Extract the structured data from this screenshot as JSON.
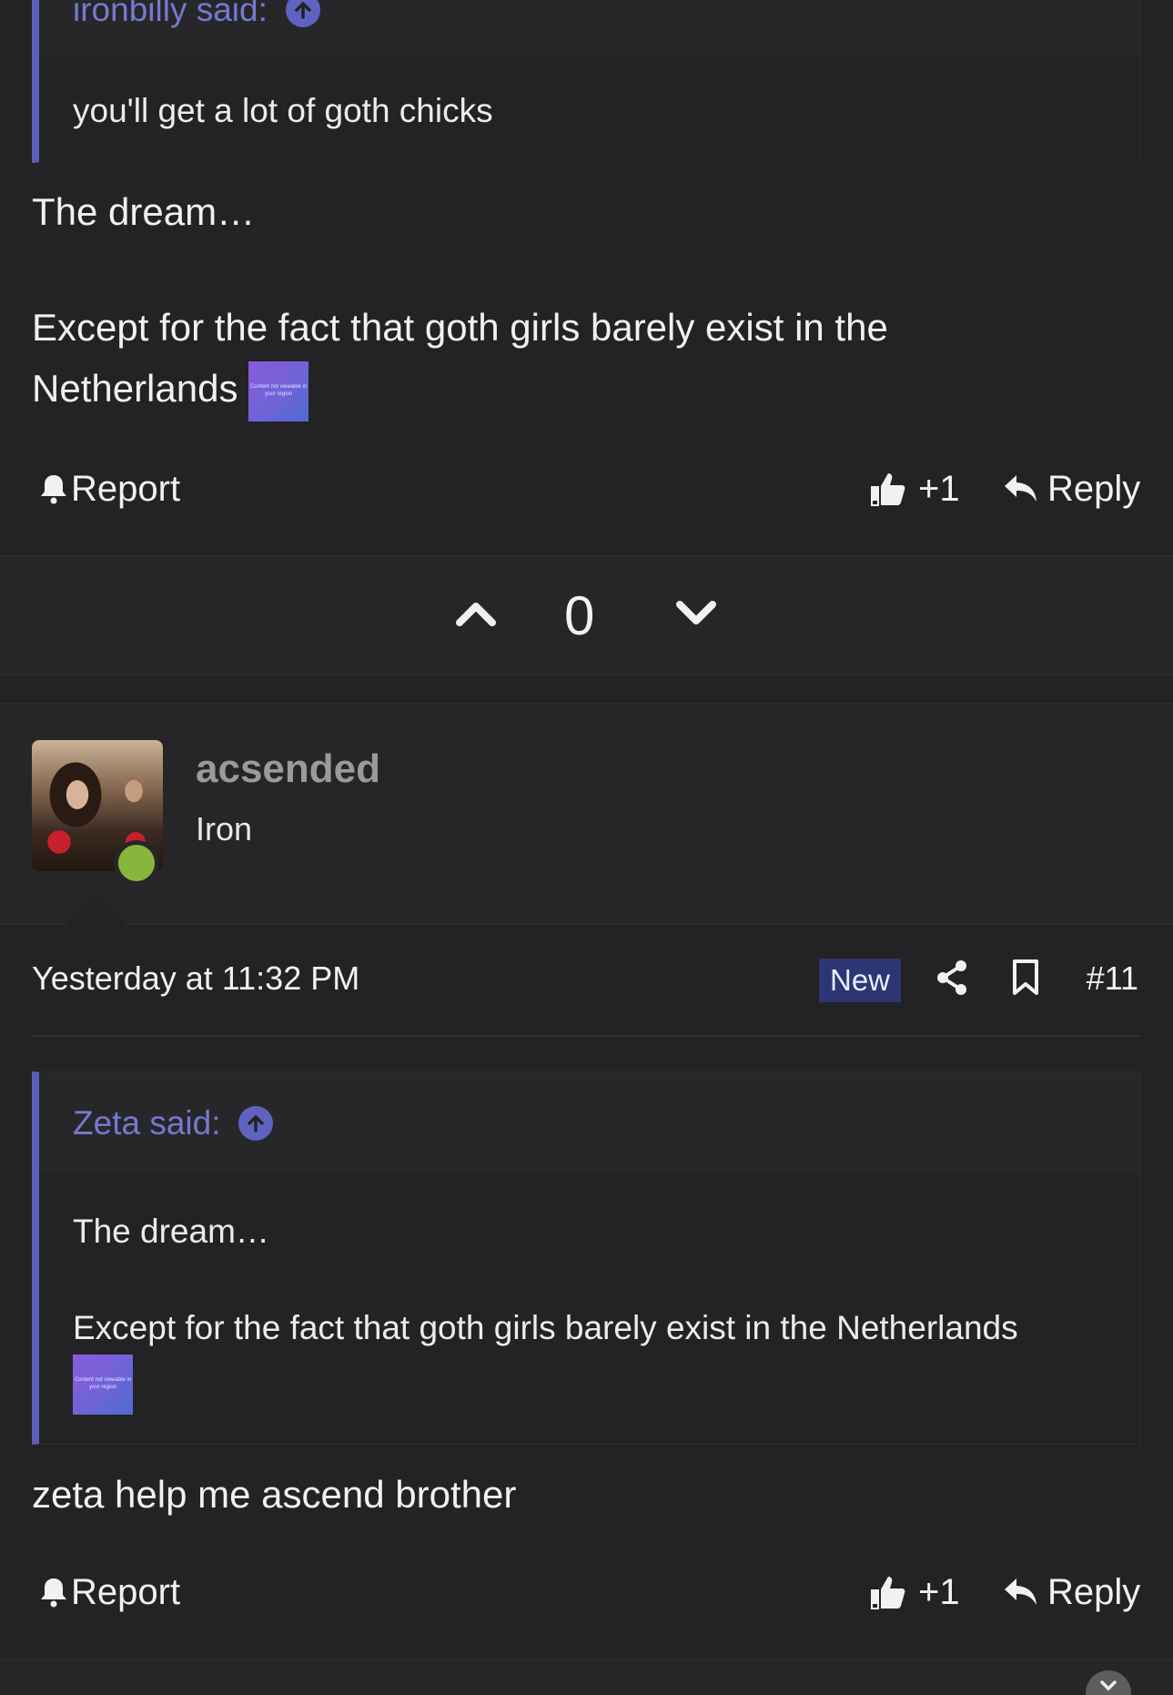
{
  "quote1": {
    "author_label": "ironbilly said:",
    "text": "you'll get a lot of goth chicks"
  },
  "post1": {
    "line1": "The dream…",
    "line2a": "Except for the fact that goth girls barely exist in the",
    "line2b": "Netherlands",
    "embed_label": "Content not viewable in your region",
    "report_label": "Report",
    "like_label": "+1",
    "reply_label": "Reply"
  },
  "vote": {
    "count": "0"
  },
  "post2": {
    "username": "acsended",
    "user_title": "Iron",
    "timestamp": "Yesterday at 11:32 PM",
    "new_badge": "New",
    "post_number": "#11",
    "quote": {
      "author_label": "Zeta said:",
      "line1": "The dream…",
      "line2": "Except for the fact that goth girls barely exist in the Netherlands",
      "embed_label": "Content not viewable in your region"
    },
    "text": "zeta help me ascend brother",
    "report_label": "Report",
    "like_label": "+1",
    "reply_label": "Reply"
  },
  "colors": {
    "background": "#232325",
    "quote_accent": "#5c5fb7",
    "new_badge": "#2c3672",
    "online_status": "#89b53c"
  }
}
